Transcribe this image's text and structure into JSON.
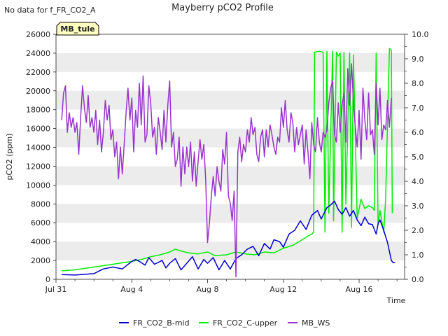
{
  "note_text": "No data for f_FR_CO2_A",
  "chart_data": {
    "type": "line",
    "title": "Mayberry pCO2 Profile",
    "xlabel": "Time",
    "ylabel": "pCO2 (ppm)",
    "ylim": [
      0,
      26000
    ],
    "y2lim": [
      0,
      10
    ],
    "yticks": [
      0,
      2000,
      4000,
      6000,
      8000,
      10000,
      12000,
      14000,
      16000,
      18000,
      20000,
      22000,
      24000,
      26000
    ],
    "y2ticks": [
      0.0,
      1.0,
      2.0,
      3.0,
      4.0,
      5.0,
      6.0,
      7.0,
      8.0,
      9.0,
      10.0
    ],
    "y2tick_labels": [
      "0.0",
      "1.0",
      "2.0",
      "3.0",
      "4.0",
      "5.0",
      "6.0",
      "7.0",
      "8.0",
      "9.0",
      "10.0"
    ],
    "xlim": [
      0,
      18.4
    ],
    "xticks": [
      0,
      4,
      8,
      12,
      16
    ],
    "xtick_labels": [
      "Jul 31",
      "Aug 4",
      "Aug 8",
      "Aug 12",
      "Aug 16"
    ],
    "grid": "horizontal bands",
    "legend_position": "bottom",
    "annotation": "MB_tule",
    "series": [
      {
        "name": "FR_CO2_B-mid",
        "color": "#0000cc",
        "axis": "left",
        "x": [
          0.3,
          1.0,
          2.0,
          2.5,
          3.0,
          3.5,
          4.0,
          4.2,
          4.4,
          4.7,
          4.9,
          5.2,
          5.4,
          5.6,
          5.8,
          6.0,
          6.3,
          6.6,
          6.9,
          7.2,
          7.5,
          7.8,
          8.0,
          8.3,
          8.6,
          8.9,
          9.2,
          9.5,
          9.8,
          10.1,
          10.4,
          10.7,
          11.0,
          11.3,
          11.5,
          11.8,
          12.0,
          12.3,
          12.6,
          12.9,
          13.2,
          13.5,
          13.8,
          14.0,
          14.3,
          14.5,
          14.7,
          14.9,
          15.1,
          15.3,
          15.5,
          15.7,
          15.9,
          16.1,
          16.3,
          16.5,
          16.7,
          16.9,
          17.0,
          17.1,
          17.3,
          17.5,
          17.7
        ],
        "y": [
          500,
          450,
          600,
          1100,
          1300,
          1100,
          1900,
          2100,
          1900,
          1500,
          2300,
          1600,
          1800,
          2000,
          1200,
          1700,
          2200,
          1000,
          1700,
          2400,
          1100,
          2100,
          1700,
          2300,
          1000,
          2000,
          1100,
          2200,
          2600,
          3200,
          3500,
          2500,
          3800,
          3200,
          4200,
          4000,
          3400,
          4800,
          5200,
          6200,
          5300,
          6800,
          7300,
          6400,
          7600,
          7900,
          8300,
          7400,
          6900,
          7600,
          6700,
          7300,
          6300,
          5700,
          6600,
          5900,
          5800,
          4800,
          5900,
          6300,
          5200,
          3900,
          2000
        ],
        "y_more": [
          1750,
          1800
        ]
      },
      {
        "name": "FR_CO2_C-upper",
        "color": "#00ee00",
        "axis": "left",
        "x": [
          0.3,
          1.0,
          2.0,
          3.0,
          4.0,
          4.5,
          5.0,
          5.5,
          6.0,
          6.3,
          6.6,
          7.0,
          7.5,
          8.0,
          8.4,
          9.0,
          9.5,
          10.0,
          10.5,
          11.0,
          11.5,
          12.0,
          12.5,
          13.0,
          13.3,
          13.5,
          13.6,
          13.65,
          13.9,
          14.1,
          14.2,
          14.3,
          14.4,
          14.6,
          14.65,
          14.8,
          14.9,
          15.0,
          15.1,
          15.2,
          15.3,
          15.5,
          15.6,
          15.7,
          15.9,
          16.1,
          16.3,
          16.5,
          16.7,
          16.8,
          16.9,
          17.0,
          17.1,
          17.3,
          17.4,
          17.6,
          17.7,
          17.75
        ],
        "y": [
          900,
          1000,
          1300,
          1600,
          1900,
          2100,
          2400,
          2600,
          2900,
          3200,
          3000,
          2800,
          2700,
          2900,
          2500,
          2600,
          2900,
          2700,
          2600,
          2900,
          2800,
          3300,
          3600,
          4200,
          4600,
          4800,
          5000,
          24100,
          24200,
          24100,
          5000,
          24200,
          7000,
          24200,
          6200,
          24100,
          23700,
          24000,
          5000,
          24100,
          8000,
          24000,
          5500,
          23800,
          6500,
          8500,
          7500,
          7800,
          7600,
          7300,
          24000,
          5800,
          7300,
          5000,
          8500,
          24500,
          24300,
          7000
        ]
      },
      {
        "name": "MB_WS",
        "color": "#9933cc",
        "axis": "right",
        "x": [
          0.3,
          0.4,
          0.5,
          0.6,
          0.7,
          0.8,
          0.9,
          1.0,
          1.1,
          1.2,
          1.3,
          1.4,
          1.5,
          1.6,
          1.7,
          1.8,
          1.9,
          2.0,
          2.1,
          2.2,
          2.3,
          2.4,
          2.5,
          2.6,
          2.7,
          2.8,
          2.9,
          3.0,
          3.1,
          3.2,
          3.3,
          3.4,
          3.5,
          3.6,
          3.7,
          3.8,
          3.9,
          4.0,
          4.1,
          4.2,
          4.3,
          4.4,
          4.5,
          4.6,
          4.7,
          4.8,
          4.9,
          5.0,
          5.1,
          5.2,
          5.3,
          5.4,
          5.5,
          5.6,
          5.7,
          5.8,
          5.9,
          6.0,
          6.1,
          6.2,
          6.3,
          6.4,
          6.5,
          6.6,
          6.7,
          6.8,
          6.9,
          7.0,
          7.1,
          7.2,
          7.3,
          7.4,
          7.5,
          7.6,
          7.7,
          7.8,
          7.9,
          8.0,
          8.1,
          8.2,
          8.3,
          8.4,
          8.5,
          8.6,
          8.7,
          8.8,
          8.9,
          9.0,
          9.1,
          9.2,
          9.3,
          9.4,
          9.5,
          9.6,
          9.7,
          9.8,
          9.9,
          10.0,
          10.1,
          10.2,
          10.3,
          10.4,
          10.5,
          10.6,
          10.7,
          10.8,
          10.9,
          11.0,
          11.1,
          11.2,
          11.3,
          11.4,
          11.5,
          11.6,
          11.7,
          11.8,
          11.9,
          12.0,
          12.1,
          12.2,
          12.3,
          12.4,
          12.5,
          12.6,
          12.7,
          12.8,
          12.9,
          13.0,
          13.1,
          13.2,
          13.3,
          13.4,
          13.5,
          13.6,
          13.7,
          13.8,
          13.9,
          14.0,
          14.1,
          14.2,
          14.3,
          14.4,
          14.5,
          14.6,
          14.7,
          14.8,
          14.9,
          15.0,
          15.1,
          15.2,
          15.3,
          15.4,
          15.5,
          15.6,
          15.7,
          15.8,
          15.9,
          16.0,
          16.1,
          16.2,
          16.3,
          16.4,
          16.5,
          16.6,
          16.7,
          16.8,
          16.9,
          17.0,
          17.1,
          17.2,
          17.3,
          17.4,
          17.5,
          17.6,
          17.7
        ],
        "y": [
          6.5,
          7.6,
          7.9,
          6.0,
          6.8,
          6.2,
          6.6,
          6.0,
          6.4,
          5.1,
          6.6,
          7.9,
          7.0,
          6.4,
          7.5,
          6.2,
          6.6,
          6.0,
          6.9,
          5.5,
          6.5,
          5.2,
          6.0,
          7.3,
          6.5,
          7.1,
          5.7,
          6.1,
          5.0,
          5.6,
          4.1,
          5.4,
          4.3,
          5.5,
          6.8,
          7.8,
          6.5,
          7.4,
          5.2,
          6.9,
          6.2,
          8.0,
          6.3,
          8.3,
          5.6,
          5.9,
          7.9,
          7.2,
          5.8,
          6.2,
          5.1,
          6.6,
          6.0,
          5.3,
          6.9,
          5.6,
          7.1,
          8.1,
          5.4,
          6.0,
          4.6,
          4.9,
          5.8,
          3.8,
          5.4,
          4.3,
          5.4,
          4.6,
          5.6,
          4.0,
          5.2,
          3.8,
          4.8,
          5.7,
          4.9,
          5.5,
          4.1,
          1.5,
          2.3,
          3.4,
          4.2,
          3.4,
          4.6,
          4.0,
          3.6,
          5.3,
          4.7,
          6.0,
          3.4,
          3.1,
          2.4,
          3.6,
          0.1,
          5.2,
          5.8,
          4.8,
          5.5,
          5.2,
          6.1,
          5.6,
          6.6,
          5.9,
          6.2,
          5.1,
          4.8,
          5.8,
          6.1,
          5.0,
          6.1,
          5.4,
          6.3,
          5.9,
          5.4,
          5.1,
          5.8,
          5.6,
          7.0,
          6.2,
          7.3,
          6.1,
          5.6,
          6.8,
          6.4,
          5.2,
          6.2,
          5.5,
          5.9,
          6.3,
          4.7,
          6.1,
          5.2,
          4.1,
          6.4,
          5.5,
          5.2,
          6.6,
          5.6,
          5.2,
          6.0,
          5.8,
          6.1,
          7.2,
          7.8,
          8.1,
          5.9,
          5.6,
          7.2,
          6.0,
          7.1,
          7.6,
          5.6,
          8.6,
          7.1,
          8.8,
          7.2,
          6.2,
          5.4,
          6.9,
          4.9,
          7.8,
          6.5,
          5.7,
          7.6,
          5.9,
          6.1,
          5.1,
          8.0,
          6.3,
          7.8,
          5.7,
          6.3,
          6.1,
          7.3,
          6.2,
          7.4
        ]
      }
    ]
  }
}
